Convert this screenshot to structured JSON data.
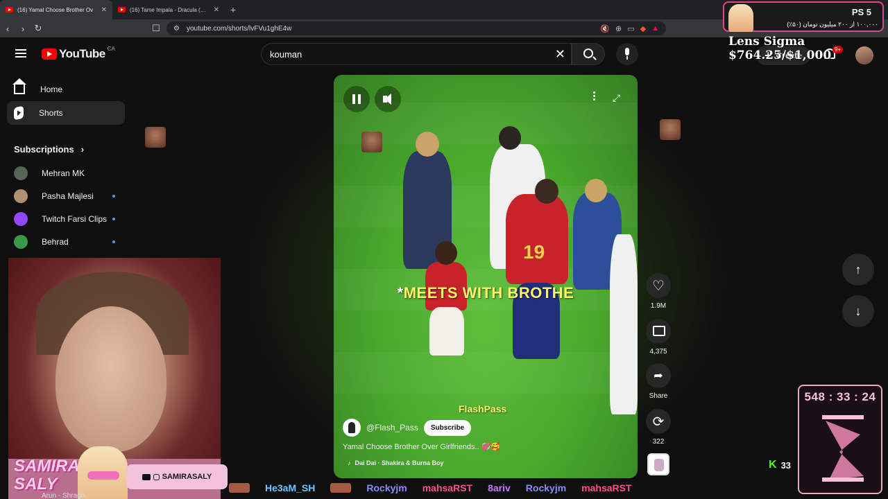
{
  "browser": {
    "tabs": [
      {
        "title": "(16) Yamal Choose Brother Ov",
        "active": true
      },
      {
        "title": "(16) Tame Impala - Dracula (Official V",
        "active": false
      }
    ],
    "url": "youtube.com/shorts/lvFVu1ghE4w"
  },
  "header": {
    "logo_text": "YouTube",
    "country": "CA",
    "search_value": "kouman",
    "create_label": "Create",
    "notification_badge": "9+"
  },
  "sidebar": {
    "home": "Home",
    "shorts": "Shorts",
    "subscriptions_label": "Subscriptions",
    "subscriptions": [
      {
        "name": "Mehran MK",
        "color": "#556655",
        "new": false
      },
      {
        "name": "Pasha Majlesi",
        "color": "#b09070",
        "new": true
      },
      {
        "name": "Twitch Farsi Clips",
        "color": "#9146ff",
        "new": true
      },
      {
        "name": "Behrad",
        "color": "#3a9a4a",
        "new": true
      }
    ]
  },
  "video": {
    "caption_star": "*",
    "caption": "MEETS WITH BROTHE",
    "watermark": "FlashPass",
    "channel": "@Flash_Pass",
    "subscribe": "Subscribe",
    "title": "Yamal Choose Brother Over Girlfriends.. 💞🥰",
    "music": "Dai Dai · Shakira & Burna Boy"
  },
  "actions": {
    "likes": "1.9M",
    "comments": "4,375",
    "share": "Share",
    "remix": "322"
  },
  "overlay": {
    "ps": "PS 5",
    "donation_fa": "۱۰۰,۰۰۰ از ۲۰۰ میلیون تومان (۵۰٪)",
    "goal": "Lens Sigma $764.25/$1,000",
    "timer": "548 : 33 : 24",
    "kick_count": "33",
    "brand_line1": "SAMIRA",
    "brand_line2": "SALY",
    "handle": "SAMIRASALY",
    "cut_text": "Arun - Shragh",
    "chat_users": [
      "He3aM_SH",
      "Rockyjm",
      "mahsaRST",
      "8ariv",
      "Rockyjm",
      "mahsaRST"
    ]
  }
}
